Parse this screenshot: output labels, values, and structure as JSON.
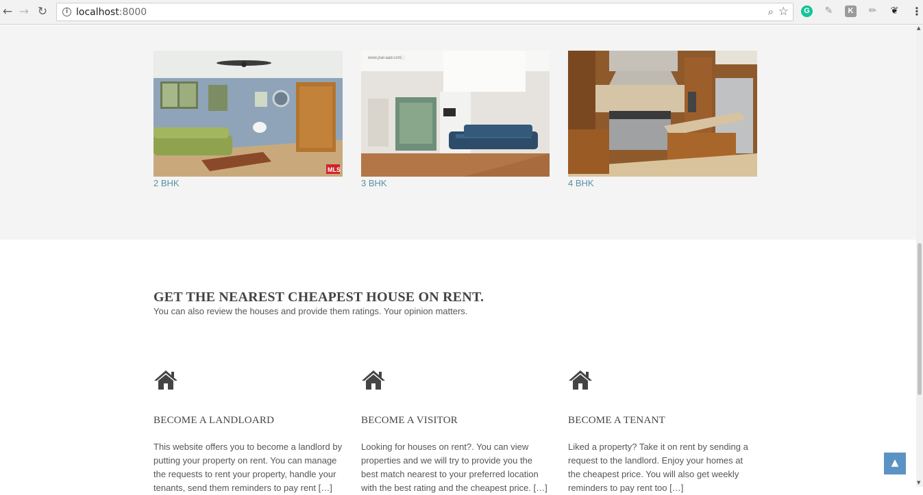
{
  "browser": {
    "url_host": "localhost",
    "url_port": ":8000",
    "back_icon": "back-arrow-icon",
    "forward_icon": "forward-arrow-icon",
    "reload_icon": "reload-icon"
  },
  "gallery": {
    "items": [
      {
        "label": "2 BHK"
      },
      {
        "label": "3 BHK"
      },
      {
        "label": "4 BHK"
      }
    ]
  },
  "intro": {
    "headline": "GET THE NEAREST CHEAPEST HOUSE ON RENT.",
    "subline": "You can also review the houses and provide them ratings. Your opinion matters."
  },
  "features": [
    {
      "title": "BECOME A LANDLOARD",
      "text": "This website offers you to become a landlord by putting your property on rent. You can manage the requests to rent your property, handle your tenants, send them reminders to pay rent […]"
    },
    {
      "title": "BECOME A VISITOR",
      "text": "Looking for houses on rent?. You can view properties and we will try to provide you the best match nearest to your preferred location with the best rating and the cheapest price. […]"
    },
    {
      "title": "BECOME A TENANT",
      "text": "Liked a property? Take it on rent by sending a request to the landlord. Enjoy your homes at the cheapest price. You will also get weekly reminders to pay rent too […]"
    }
  ],
  "colors": {
    "link": "#5a8fa8",
    "to_top": "#5b93c4",
    "section_gray": "#f4f4f4"
  }
}
